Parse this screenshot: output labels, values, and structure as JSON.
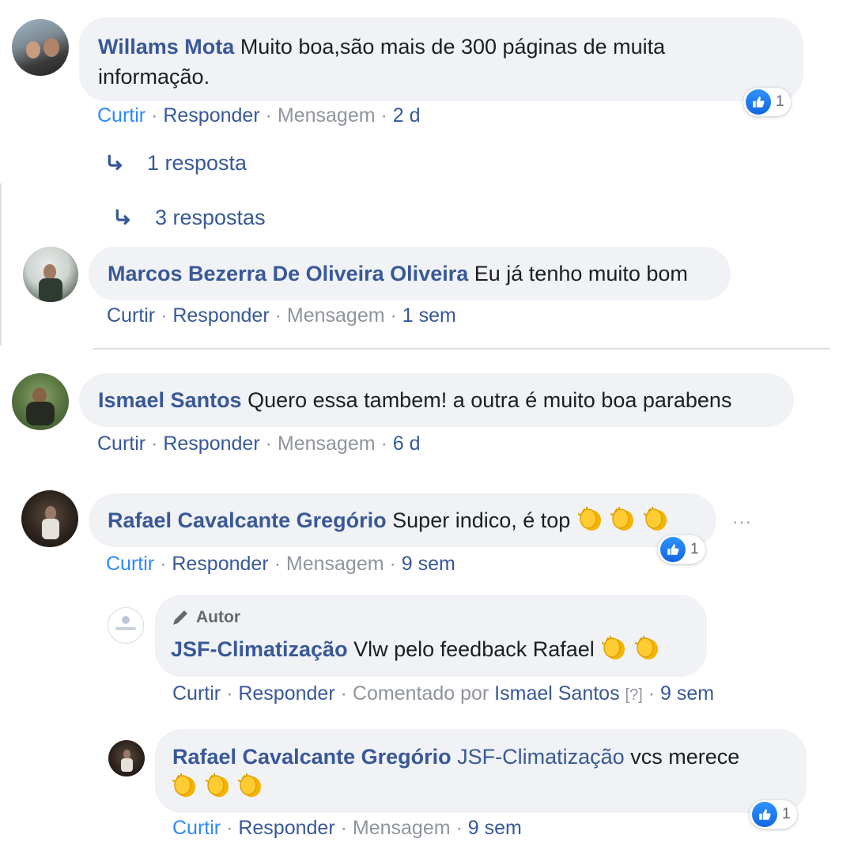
{
  "common": {
    "like": "Curtir",
    "reply": "Responder",
    "message": "Mensagem",
    "sep": "·"
  },
  "comments": [
    {
      "author": "Willams Mota",
      "text_line1": "Muito boa,são mais de 300 páginas de muita",
      "text_line2": "informação.",
      "time": "2 d",
      "reactions": "1",
      "replies_toggle_1": "1 resposta",
      "replies_toggle_2": "3 respostas"
    },
    {
      "author": "Marcos Bezerra De Oliveira Oliveira",
      "text": "Eu já tenho muito bom",
      "time": "1 sem"
    },
    {
      "author": "Ismael Santos",
      "text": "Quero essa tambem! a outra é muito boa parabens",
      "time": "6 d"
    },
    {
      "author": "Rafael Cavalcante Gregório",
      "text": "Super indico, é top",
      "time": "9 sem",
      "reactions": "1",
      "more": "···"
    }
  ],
  "replies": [
    {
      "badge": "Autor",
      "author": "JSF-Climatização",
      "text": "Vlw pelo feedback Rafael",
      "commented_by_label": "Comentado por",
      "commented_by_name": "Ismael Santos",
      "help": "[?]",
      "time": "9 sem"
    },
    {
      "author": "Rafael Cavalcante Gregório",
      "mention": "JSF-Climatização",
      "text": "vcs merece",
      "time": "9 sem",
      "reactions": "1"
    }
  ],
  "colors": {
    "link": "#385898",
    "bubble": "#f0f2f5",
    "like_blue": "#1877f2",
    "muted": "#90949c"
  }
}
